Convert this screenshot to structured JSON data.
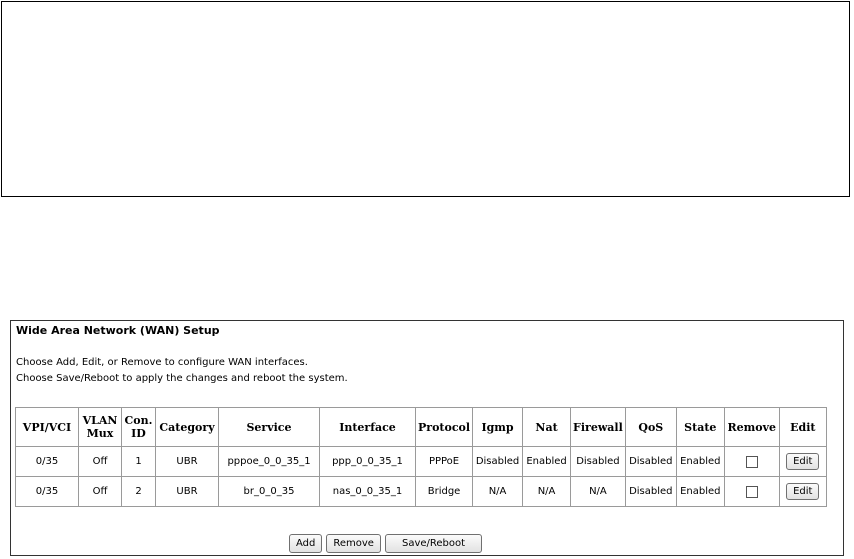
{
  "wan": {
    "title": "Wide Area Network (WAN) Setup",
    "desc_line1": "Choose Add, Edit, or Remove to configure WAN interfaces.",
    "desc_line2": "Choose Save/Reboot to apply the changes and reboot the system.",
    "headers": {
      "vpi_vci": "VPI/VCI",
      "vlan_mux": [
        "VLAN",
        "Mux"
      ],
      "con_id": [
        "Con.",
        "ID"
      ],
      "category": "Category",
      "service": "Service",
      "interface": "Interface",
      "protocol": "Protocol",
      "igmp": "Igmp",
      "nat": "Nat",
      "firewall": "Firewall",
      "qos": "QoS",
      "state": "State",
      "remove": "Remove",
      "edit": "Edit"
    },
    "rows": [
      {
        "vpi_vci": "0/35",
        "vlan_mux": "Off",
        "con_id": "1",
        "category": "UBR",
        "service": "pppoe_0_0_35_1",
        "interface": "ppp_0_0_35_1",
        "protocol": "PPPoE",
        "igmp": "Disabled",
        "nat": "Enabled",
        "firewall": "Disabled",
        "qos": "Disabled",
        "state": "Enabled",
        "remove_checked": false,
        "edit_label": "Edit"
      },
      {
        "vpi_vci": "0/35",
        "vlan_mux": "Off",
        "con_id": "2",
        "category": "UBR",
        "service": "br_0_0_35",
        "interface": "nas_0_0_35_1",
        "protocol": "Bridge",
        "igmp": "N/A",
        "nat": "N/A",
        "firewall": "N/A",
        "qos": "Disabled",
        "state": "Enabled",
        "remove_checked": false,
        "edit_label": "Edit"
      }
    ],
    "buttons": {
      "add": "Add",
      "remove": "Remove",
      "save_reboot": "Save/Reboot"
    }
  }
}
